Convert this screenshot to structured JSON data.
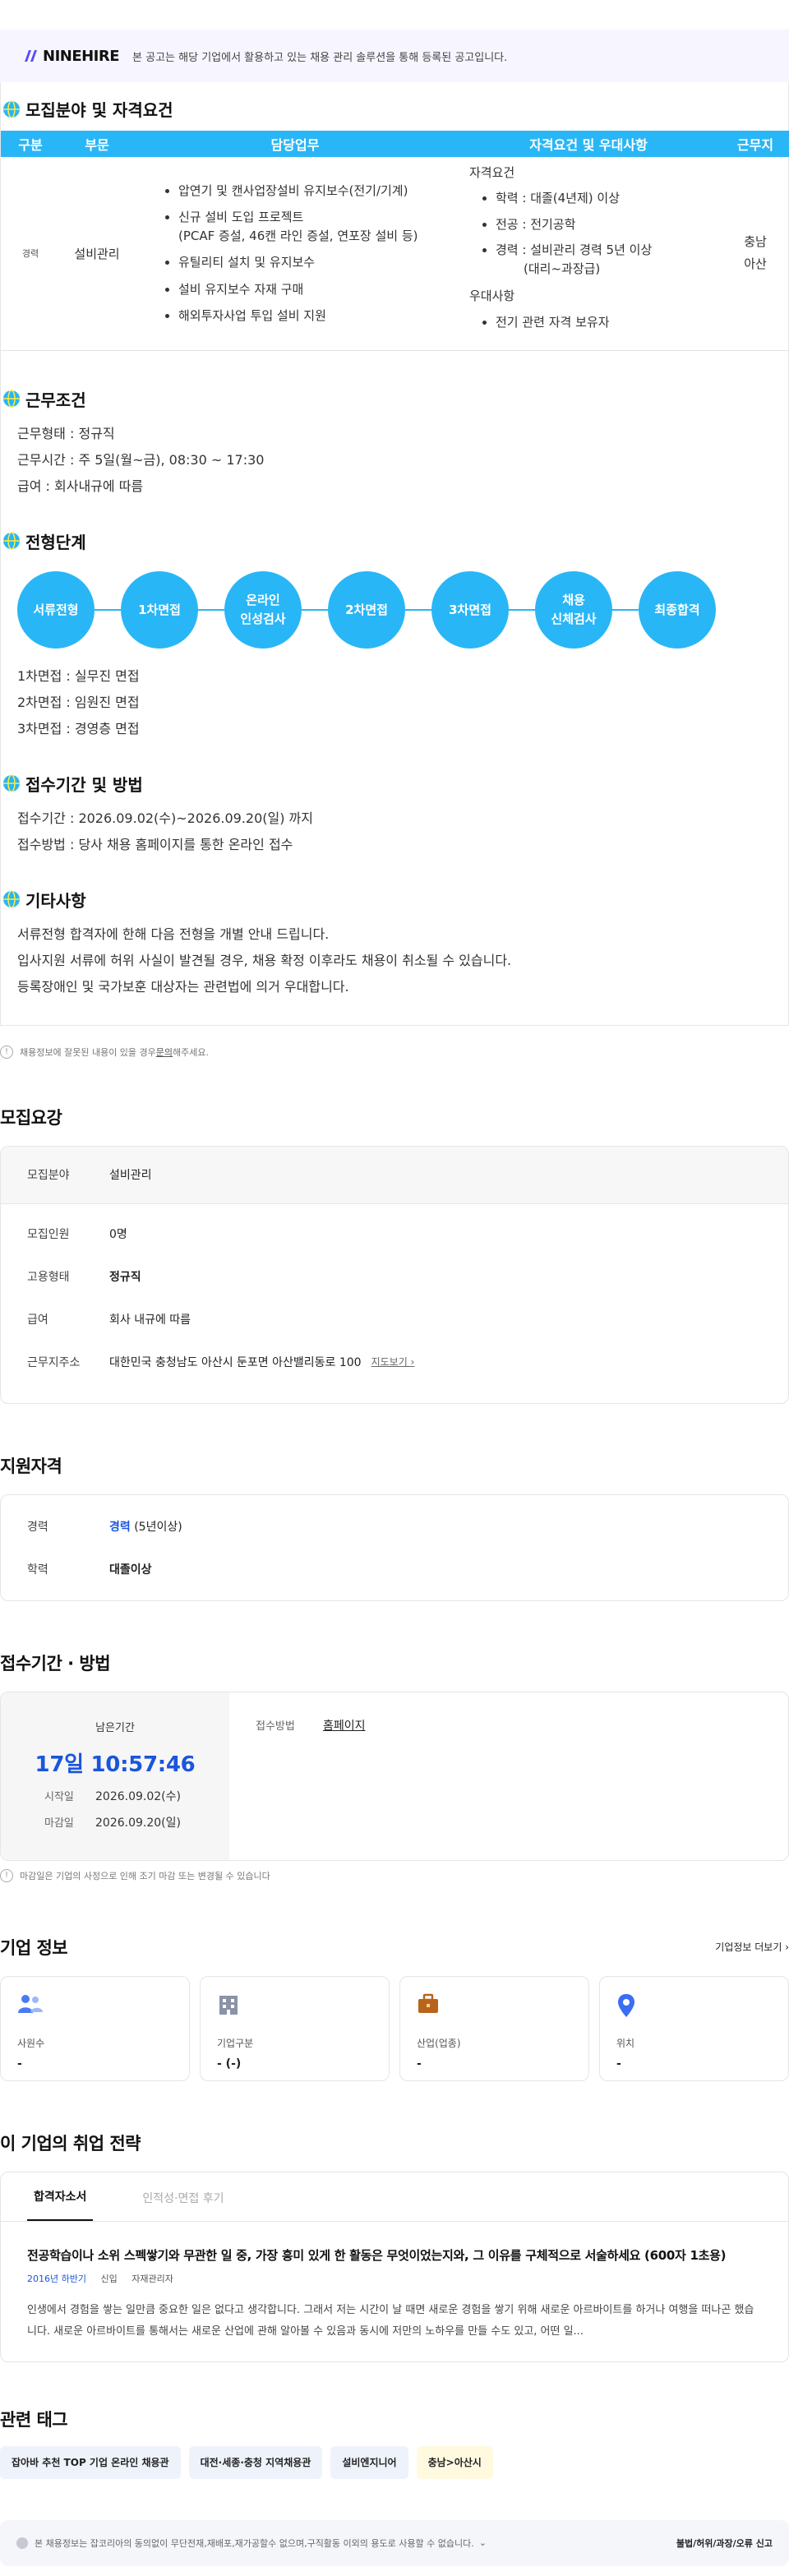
{
  "top_notice": {
    "brand": "NINEHIRE",
    "text": "본 공고는 해당 기업에서 활용하고 있는 채용 관리 솔루션을 통해 등록된 공고입니다."
  },
  "jd": {
    "recruit_title": "모집분야 및 자격요건",
    "table_headers": [
      "구분",
      "부문",
      "담당업무",
      "자격요건 및 우대사항",
      "근무지"
    ],
    "row": {
      "category": "경력",
      "dept": "설비관리",
      "duties": [
        "압연기 및 캔사업장설비 유지보수(전기/기계)",
        "신규 설비 도입 프로젝트",
        "(PCAF 증설, 46캔 라인 증설, 연포장 설비 등)",
        "유틸리티 설치 및 유지보수",
        "설비 유지보수 자재 구매",
        "해외투자사업 투입 설비 지원"
      ],
      "qual_label": "자격요건",
      "quals": [
        "학력 : 대졸(4년제) 이상",
        "전공 : 전기공학",
        "경력 : 설비관리 경력 5년 이상"
      ],
      "qual_sub": "(대리~과장급)",
      "pref_label": "우대사항",
      "prefs": [
        "전기 관련 자격 보유자"
      ],
      "location_1": "충남",
      "location_2": "아산"
    },
    "work_title": "근무조건",
    "work_lines": [
      "근무형태 : 정규직",
      "근무시간 : 주 5일(월~금), 08:30 ~ 17:30",
      "급여 : 회사내규에 따름"
    ],
    "steps_title": "전형단계",
    "steps": [
      "서류전형",
      "1차면접",
      "온라인\n인성검사",
      "2차면접",
      "3차면접",
      "채용\n신체검사",
      "최종합격"
    ],
    "interview_lines": [
      "1차면접 : 실무진 면접",
      "2차면접 : 임원진 면접",
      "3차면접 : 경영층 면접"
    ],
    "apply_title": "접수기간 및 방법",
    "apply_lines": [
      "접수기간 : 2026.09.02(수)~2026.09.20(일) 까지",
      "접수방법 : 당사 채용 홈페이지를 통한 온라인 접수"
    ],
    "etc_title": "기타사항",
    "etc_lines": [
      "서류전형 합격자에 한해 다음 전형을 개별 안내 드립니다.",
      "입사지원 서류에 허위 사실이 발견될 경우, 채용 확정 이후라도 채용이 취소될 수 있습니다.",
      "등록장애인 및 국가보훈 대상자는 관련법에 의거 우대합니다."
    ]
  },
  "report": {
    "pre": "채용정보에 잘못된 내용이 있을 경우 ",
    "link": "문의",
    "post": "해주세요."
  },
  "summary": {
    "title": "모집요강",
    "field_label": "모집분야",
    "field_value": "설비관리",
    "count_label": "모집인원",
    "count_value": "0명",
    "type_label": "고용형태",
    "type_value": "정규직",
    "pay_label": "급여",
    "pay_value": "회사 내규에 따름",
    "addr_label": "근무지주소",
    "addr_value": "대한민국 충청남도 아산시 둔포면 아산밸리동로 100",
    "map_link": "지도보기 ›"
  },
  "qualification": {
    "title": "지원자격",
    "career_label": "경력",
    "career_value": "경력",
    "career_extra": "(5년이상)",
    "edu_label": "학력",
    "edu_value": "대졸이상"
  },
  "deadline": {
    "title": "접수기간 · 방법",
    "remain_label": "남은기간",
    "timer": "17일 10:57:46",
    "start_label": "시작일",
    "start_value": "2026.09.02(수)",
    "end_label": "마감일",
    "end_value": "2026.09.20(일)",
    "method_label": "접수방법",
    "method_value": "홈페이지",
    "note": "마감일은 기업의 사정으로 인해 조기 마감 또는 변경될 수 있습니다"
  },
  "company": {
    "title": "기업 정보",
    "more": "기업정보 더보기 ›",
    "cards": [
      {
        "label": "사원수",
        "value": "-",
        "icon": "people-icon",
        "color": "#4a7bf0"
      },
      {
        "label": "기업구분",
        "value": "- (-)",
        "icon": "building-icon",
        "color": "#8a94a6"
      },
      {
        "label": "산업(업종)",
        "value": "-",
        "icon": "briefcase-icon",
        "color": "#b8641c"
      },
      {
        "label": "위치",
        "value": "-",
        "icon": "location-pin-icon",
        "color": "#3b6ef5"
      }
    ]
  },
  "strategy": {
    "title": "이 기업의 취업 전략",
    "tabs": [
      "합격자소서",
      "인적성·면접 후기"
    ],
    "question": "전공학습이나 소위 스펙쌓기와 무관한 일 중, 가장 흥미 있게 한 활동은 무엇이었는지와, 그 이유를 구체적으로 서술하세요 (600자 1초용)",
    "meta_period": "2016년 하반기",
    "meta_type": "신입",
    "meta_role": "자재관리자",
    "body": "인생에서 경험을 쌓는 일만큼 중요한 일은 없다고 생각합니다. 그래서 저는 시간이 날 때면 새로운 경험을 쌓기 위해 새로운 아르바이트를 하거나 여행을 떠나곤 했습니다. 새로운 아르바이트를 통해서는 새로운 산업에 관해 알아볼 수 있음과 동시에 저만의 노하우를 만들 수도 있고, 어떤 일..."
  },
  "tags": {
    "title": "관련 태그",
    "items": [
      "잡아바 추천 TOP 기업 온라인 채용관",
      "대전·세종·충청 지역채용관",
      "설비엔지니어",
      "충남>아산시"
    ]
  },
  "footer": {
    "text": "본 채용정보는 잡코리아의 동의없이 무단전재,재배포,재가공할수 없으며,구직활동 이외의 용도로 사용할 수 없습니다.",
    "right": "불법/허위/과장/오류 신고"
  }
}
